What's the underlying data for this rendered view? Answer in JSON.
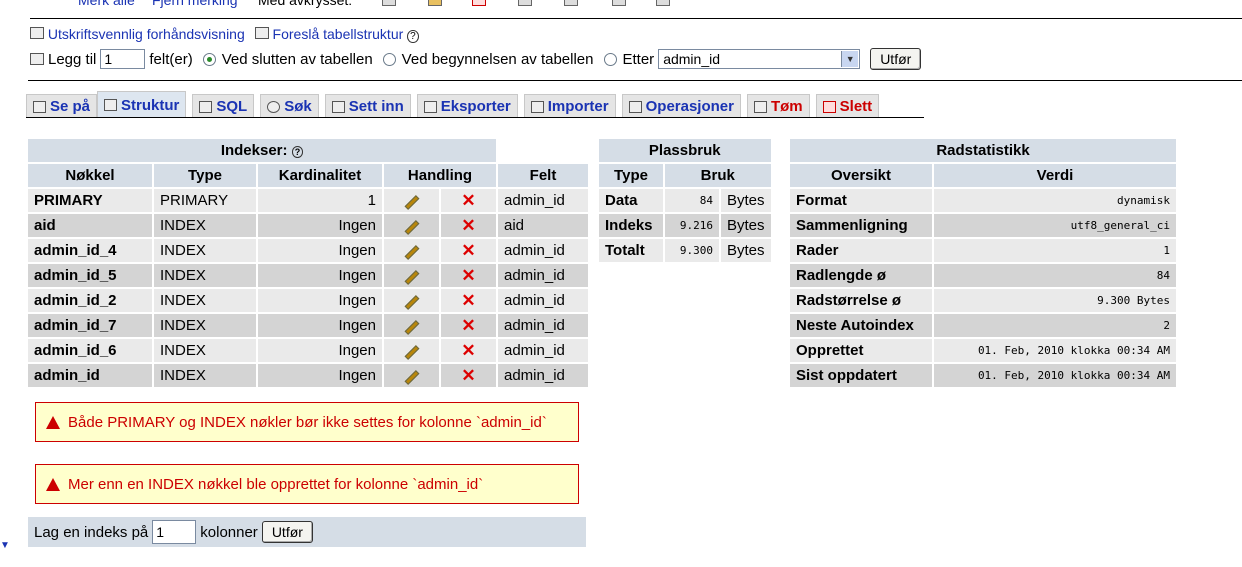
{
  "top": {
    "fragment_1": "Merk alle",
    "fragment_2": "Fjern merking",
    "fragment_3": "Med avkrysset:"
  },
  "links": {
    "print_preview": "Utskriftsvennlig forhåndsvisning",
    "propose_structure": "Foreslå tabellstruktur"
  },
  "add_fields": {
    "prefix": "Legg til",
    "count_value": "1",
    "suffix": "felt(er)",
    "options": [
      "Ved slutten av tabellen",
      "Ved begynnelsen av tabellen",
      "Etter"
    ],
    "selected_option_index": 0,
    "after_select_value": "admin_id",
    "go_label": "Utfør"
  },
  "tabs": [
    {
      "label": "Se på",
      "icon": "browse-icon"
    },
    {
      "label": "Struktur",
      "icon": "structure-icon",
      "active": true
    },
    {
      "label": "SQL",
      "icon": "sql-icon"
    },
    {
      "label": "Søk",
      "icon": "search-icon"
    },
    {
      "label": "Sett inn",
      "icon": "insert-icon"
    },
    {
      "label": "Eksporter",
      "icon": "export-icon"
    },
    {
      "label": "Importer",
      "icon": "import-icon"
    },
    {
      "label": "Operasjoner",
      "icon": "operations-icon"
    },
    {
      "label": "Tøm",
      "icon": "empty-icon",
      "color": "#cc0000"
    },
    {
      "label": "Slett",
      "icon": "drop-icon",
      "color": "#cc0000"
    }
  ],
  "indexes": {
    "title": "Indekser:",
    "headers": [
      "Nøkkel",
      "Type",
      "Kardinalitet",
      "Handling",
      "Felt"
    ],
    "rows": [
      {
        "key": "PRIMARY",
        "type": "PRIMARY",
        "cardinality": "1",
        "field": "admin_id"
      },
      {
        "key": "aid",
        "type": "INDEX",
        "cardinality": "Ingen",
        "field": "aid"
      },
      {
        "key": "admin_id_4",
        "type": "INDEX",
        "cardinality": "Ingen",
        "field": "admin_id"
      },
      {
        "key": "admin_id_5",
        "type": "INDEX",
        "cardinality": "Ingen",
        "field": "admin_id"
      },
      {
        "key": "admin_id_2",
        "type": "INDEX",
        "cardinality": "Ingen",
        "field": "admin_id"
      },
      {
        "key": "admin_id_7",
        "type": "INDEX",
        "cardinality": "Ingen",
        "field": "admin_id"
      },
      {
        "key": "admin_id_6",
        "type": "INDEX",
        "cardinality": "Ingen",
        "field": "admin_id"
      },
      {
        "key": "admin_id",
        "type": "INDEX",
        "cardinality": "Ingen",
        "field": "admin_id"
      }
    ]
  },
  "warnings": [
    "Både PRIMARY og INDEX nøkler bør ikke settes for kolonne `admin_id`",
    "Mer enn en INDEX nøkkel ble opprettet for kolonne `admin_id`"
  ],
  "create_index": {
    "prefix": "Lag en indeks på",
    "value": "1",
    "suffix": "kolonner",
    "go_label": "Utfør"
  },
  "space": {
    "title": "Plassbruk",
    "headers": [
      "Type",
      "Bruk"
    ],
    "rows": [
      {
        "type": "Data",
        "value": "84",
        "unit": "Bytes"
      },
      {
        "type": "Indeks",
        "value": "9.216",
        "unit": "Bytes"
      },
      {
        "type": "Totalt",
        "value": "9.300",
        "unit": "Bytes"
      }
    ]
  },
  "rowstats": {
    "title": "Radstatistikk",
    "headers": [
      "Oversikt",
      "Verdi"
    ],
    "rows": [
      {
        "label": "Format",
        "value": "dynamisk"
      },
      {
        "label": "Sammenligning",
        "value": "utf8_general_ci"
      },
      {
        "label": "Rader",
        "value": "1"
      },
      {
        "label": "Radlengde ø",
        "value": "84"
      },
      {
        "label": "Radstørrelse ø",
        "value": "9.300 Bytes"
      },
      {
        "label": "Neste Autoindex",
        "value": "2"
      },
      {
        "label": "Opprettet",
        "value": "01. Feb, 2010 klokka 00:34 AM"
      },
      {
        "label": "Sist oppdatert",
        "value": "01. Feb, 2010 klokka 00:34 AM"
      }
    ]
  },
  "colors": {
    "link": "#1a33b3",
    "danger": "#cc0000",
    "header_bg": "#d5dde6",
    "warning_bg": "#ffffcc"
  }
}
